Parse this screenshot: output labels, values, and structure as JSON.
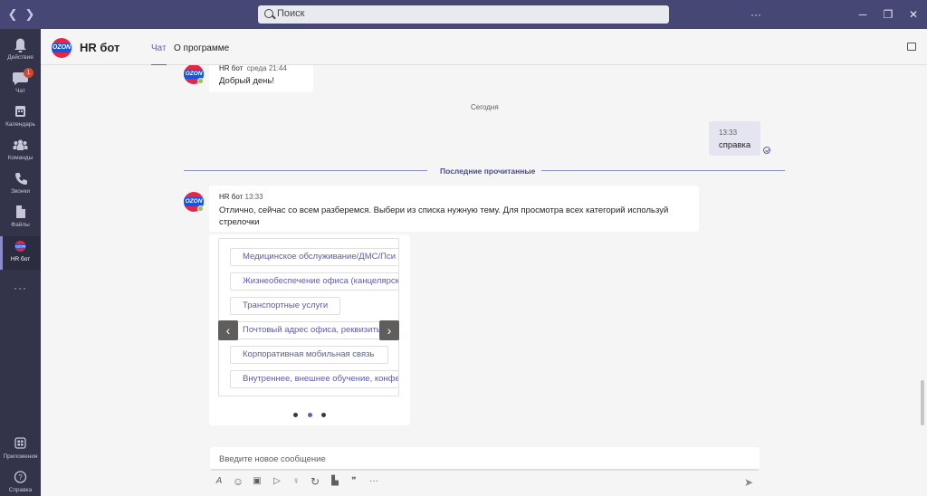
{
  "search": {
    "placeholder": "Поиск"
  },
  "titlebar": {
    "more": "···"
  },
  "rail": {
    "items": [
      {
        "label": "Действия",
        "icon": "bell-icon"
      },
      {
        "label": "Чат",
        "icon": "chat-icon",
        "badge": "1"
      },
      {
        "label": "Календарь",
        "icon": "calendar-icon"
      },
      {
        "label": "Команды",
        "icon": "teams-icon"
      },
      {
        "label": "Звонки",
        "icon": "phone-icon"
      },
      {
        "label": "Файлы",
        "icon": "file-icon"
      },
      {
        "label": "HR бот",
        "icon": "ozon-logo-icon"
      }
    ],
    "more": "···",
    "bottom": [
      {
        "label": "Приложения",
        "icon": "apps-icon"
      },
      {
        "label": "Справка",
        "icon": "help-icon"
      }
    ],
    "logo_text": "OZON"
  },
  "header": {
    "title": "HR бот",
    "tabs": [
      {
        "label": "Чат"
      },
      {
        "label": "О программе"
      }
    ],
    "logo_text": "OZON"
  },
  "chat": {
    "msg1": {
      "sender": "HR бот",
      "time": "среда 21:44",
      "text": "Добрый день!"
    },
    "date_separator": "Сегодня",
    "my_msg": {
      "time": "13:33",
      "text": "справка"
    },
    "last_read": "Последние прочитанные",
    "msg2": {
      "sender": "HR бот",
      "time": "13:33",
      "text": "Отлично, сейчас со всем разберемся. Выбери из списка нужную тему. Для просмотра всех категорий используй стрелочки"
    },
    "card": {
      "options": [
        "Медицинское обслуживание/ДМС/Пси",
        "Жизнеобеспечение офиса (канцелярск",
        "Транспортные услуги",
        "Почтовый адрес офиса, реквизиты",
        "Корпоративная мобильная связь",
        "Внутреннее, внешнее обучение, конфе"
      ],
      "prev": "‹",
      "next": "›",
      "pages": 3,
      "active_page": 2
    }
  },
  "composer": {
    "placeholder": "Введите новое сообщение",
    "tools": [
      {
        "icon": "format-icon",
        "glyph": "A"
      },
      {
        "icon": "emoji-icon",
        "glyph": "☺"
      },
      {
        "icon": "gif-icon",
        "glyph": "▣"
      },
      {
        "icon": "sticker-icon",
        "glyph": "▷"
      },
      {
        "icon": "praise-icon",
        "glyph": "♀"
      },
      {
        "icon": "loop-icon",
        "glyph": "↻"
      },
      {
        "icon": "approvals-icon",
        "glyph": "▙"
      },
      {
        "icon": "quote-icon",
        "glyph": "❞"
      },
      {
        "icon": "more-icon",
        "glyph": "···"
      }
    ],
    "send_glyph": "➤"
  },
  "colors": {
    "titlebar": "#464775",
    "rail": "#33344a",
    "accent": "#6264a7",
    "ozon_red": "#e52645",
    "ozon_blue": "#1555e6"
  }
}
